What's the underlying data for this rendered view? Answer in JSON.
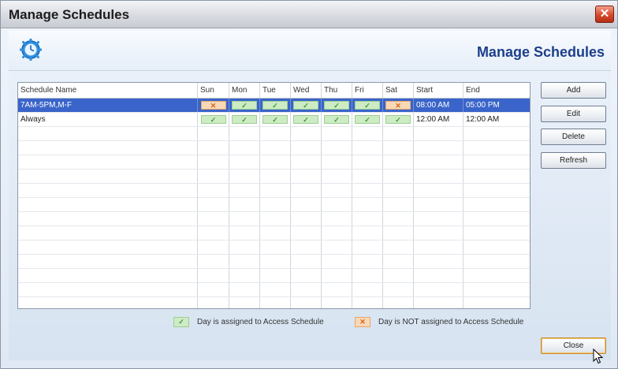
{
  "window": {
    "title": "Manage Schedules",
    "close_glyph": "✕"
  },
  "banner": {
    "title": "Manage Schedules",
    "icon": "clock-icon"
  },
  "grid": {
    "columns": [
      "Schedule Name",
      "Sun",
      "Mon",
      "Tue",
      "Wed",
      "Thu",
      "Fri",
      "Sat",
      "Start",
      "End"
    ],
    "rows": [
      {
        "name": "7AM-5PM,M-F",
        "days": [
          false,
          true,
          true,
          true,
          true,
          true,
          false
        ],
        "start": "08:00 AM",
        "end": "05:00 PM",
        "selected": true
      },
      {
        "name": "Always",
        "days": [
          true,
          true,
          true,
          true,
          true,
          true,
          true
        ],
        "start": "12:00 AM",
        "end": "12:00 AM",
        "selected": false
      }
    ]
  },
  "buttons": {
    "add": "Add",
    "edit": "Edit",
    "delete": "Delete",
    "refresh": "Refresh",
    "close": "Close"
  },
  "legend": {
    "assigned": "Day is assigned to Access Schedule",
    "not_assigned": "Day is NOT assigned to Access Schedule"
  },
  "marks": {
    "yes": "✓",
    "no": "✕"
  },
  "colors": {
    "selection": "#3a64c9",
    "assigned": "#cdebc5",
    "not_assigned": "#f8d8b6",
    "title": "#1d3f8a"
  }
}
